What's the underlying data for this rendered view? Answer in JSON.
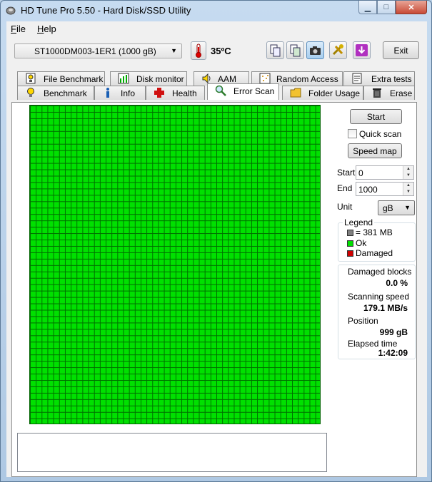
{
  "window": {
    "title": "HD Tune Pro 5.50 - Hard Disk/SSD Utility"
  },
  "menu": {
    "file": "ile",
    "file_accel": "F",
    "help": "elp",
    "help_accel": "H"
  },
  "toolbar": {
    "drive": "ST1000DM003-1ER1 (1000 gB)",
    "temperature": "35ºC",
    "exit_label": "Exit"
  },
  "tabs_top": [
    {
      "label": "File Benchmark",
      "icon": "file-benchmark-icon"
    },
    {
      "label": "Disk monitor",
      "icon": "disk-monitor-icon"
    },
    {
      "label": "AAM",
      "icon": "speaker-icon"
    },
    {
      "label": "Random Access",
      "icon": "random-access-icon"
    },
    {
      "label": "Extra tests",
      "icon": "extra-tests-icon"
    }
  ],
  "tabs_bottom": [
    {
      "label": "Benchmark",
      "icon": "lightbulb-icon"
    },
    {
      "label": "Info",
      "icon": "info-icon"
    },
    {
      "label": "Health",
      "icon": "health-cross-icon"
    },
    {
      "label": "Error Scan",
      "icon": "magnifier-icon",
      "selected": true
    },
    {
      "label": "Folder Usage",
      "icon": "folder-icon"
    },
    {
      "label": "Erase",
      "icon": "trash-icon"
    }
  ],
  "scan": {
    "start_button": "Start",
    "quick_scan_label": "Quick scan",
    "quick_scan_checked": false,
    "speed_map_button": "Speed map",
    "start_label": "Start",
    "start_value": "0",
    "end_label": "End",
    "end_value": "1000",
    "unit_label": "Unit",
    "unit_value": "gB"
  },
  "legend": {
    "title": "Legend",
    "block_size": "= 381 MB",
    "ok": "Ok",
    "damaged": "Damaged",
    "colors": {
      "block": "#808080",
      "ok": "#00e000",
      "damaged": "#d00000"
    }
  },
  "stats": {
    "damaged_blocks_label": "Damaged blocks",
    "damaged_blocks_value": "0.0 %",
    "speed_label": "Scanning speed",
    "speed_value": "179.1 MB/s",
    "position_label": "Position",
    "position_value": "999 gB",
    "elapsed_label": "Elapsed time",
    "elapsed_value": "1:42:09"
  }
}
